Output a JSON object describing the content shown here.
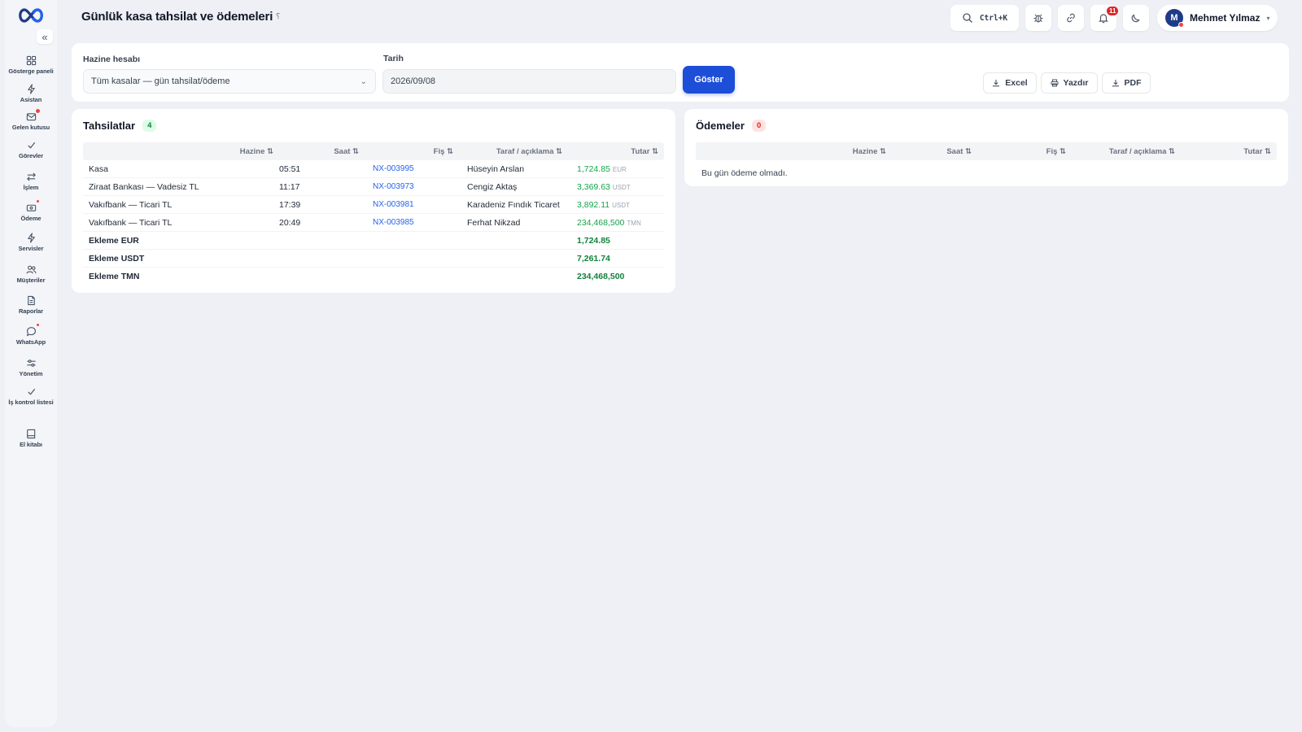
{
  "header": {
    "title": "Günlük kasa tahsilat ve ödemeleri",
    "pin_glyph": "⸮",
    "search_shortcut": "Ctrl+K",
    "notification_count": "11",
    "user": {
      "initial": "M",
      "name": "Mehmet Yılmaz",
      "caret": "▾"
    }
  },
  "sidebar": {
    "collapse_glyph": "«",
    "items": [
      {
        "label": "Gösterge paneli",
        "icon": "grid-icon"
      },
      {
        "label": "Asistan",
        "icon": "bolt-icon"
      },
      {
        "label": "Gelen kutusu",
        "icon": "inbox-icon"
      },
      {
        "label": "Görevler",
        "icon": "check-icon"
      },
      {
        "label": "İşlem",
        "icon": "swap-icon"
      },
      {
        "label": "Ödeme",
        "icon": "card-icon"
      },
      {
        "label": "Servisler",
        "icon": "bolt-icon"
      },
      {
        "label": "Müşteriler",
        "icon": "users-icon"
      },
      {
        "label": "Raporlar",
        "icon": "file-icon"
      },
      {
        "label": "WhatsApp",
        "icon": "chat-icon"
      },
      {
        "label": "Yönetim",
        "icon": "sliders-icon"
      },
      {
        "label": "İş kontrol listesi",
        "icon": "check-icon"
      },
      {
        "label": "El kitabı",
        "icon": "book-icon"
      }
    ]
  },
  "filters": {
    "account_label": "Hazine hesabı",
    "account_value": "Tüm kasalar — gün tahsilat/ödeme",
    "date_label": "Tarih",
    "date_value": "2026/09/08",
    "show_button": "Göster",
    "excel_button": "Excel",
    "print_button": "Yazdır",
    "pdf_button": "PDF"
  },
  "collections": {
    "title": "Tahsilatlar",
    "count": "4",
    "columns": [
      "Hazine ⇅",
      "Saat ⇅",
      "Fiş ⇅",
      "Taraf / açıklama ⇅",
      "Tutar ⇅"
    ],
    "rows": [
      {
        "treasury": "Kasa",
        "time": "05:51",
        "receipt": "NX-003995",
        "party": "Hüseyin Arslan",
        "amount": "1,724.85",
        "currency": "EUR"
      },
      {
        "treasury": "Ziraat Bankası — Vadesiz TL",
        "time": "11:17",
        "receipt": "NX-003973",
        "party": "Cengiz Aktaş",
        "amount": "3,369.63",
        "currency": "USDT"
      },
      {
        "treasury": "Vakıfbank — Ticari TL",
        "time": "17:39",
        "receipt": "NX-003981",
        "party": "Karadeniz Fındık Ticaret",
        "amount": "3,892.11",
        "currency": "USDT"
      },
      {
        "treasury": "Vakıfbank — Ticari TL",
        "time": "20:49",
        "receipt": "NX-003985",
        "party": "Ferhat Nikzad",
        "amount": "234,468,500",
        "currency": "TMN"
      }
    ],
    "totals": [
      {
        "label": "Ekleme EUR",
        "amount": "1,724.85"
      },
      {
        "label": "Ekleme USDT",
        "amount": "7,261.74"
      },
      {
        "label": "Ekleme TMN",
        "amount": "234,468,500"
      }
    ]
  },
  "payments": {
    "title": "Ödemeler",
    "count": "0",
    "columns": [
      "Hazine ⇅",
      "Saat ⇅",
      "Fiş ⇅",
      "Taraf / açıklama ⇅",
      "Tutar ⇅"
    ],
    "empty_text": "Bu gün ödeme olmadı."
  },
  "colors": {
    "primary": "#1d4ed8",
    "amount_green": "#16a34a",
    "link_blue": "#2563eb",
    "badge_red": "#dc2626"
  }
}
